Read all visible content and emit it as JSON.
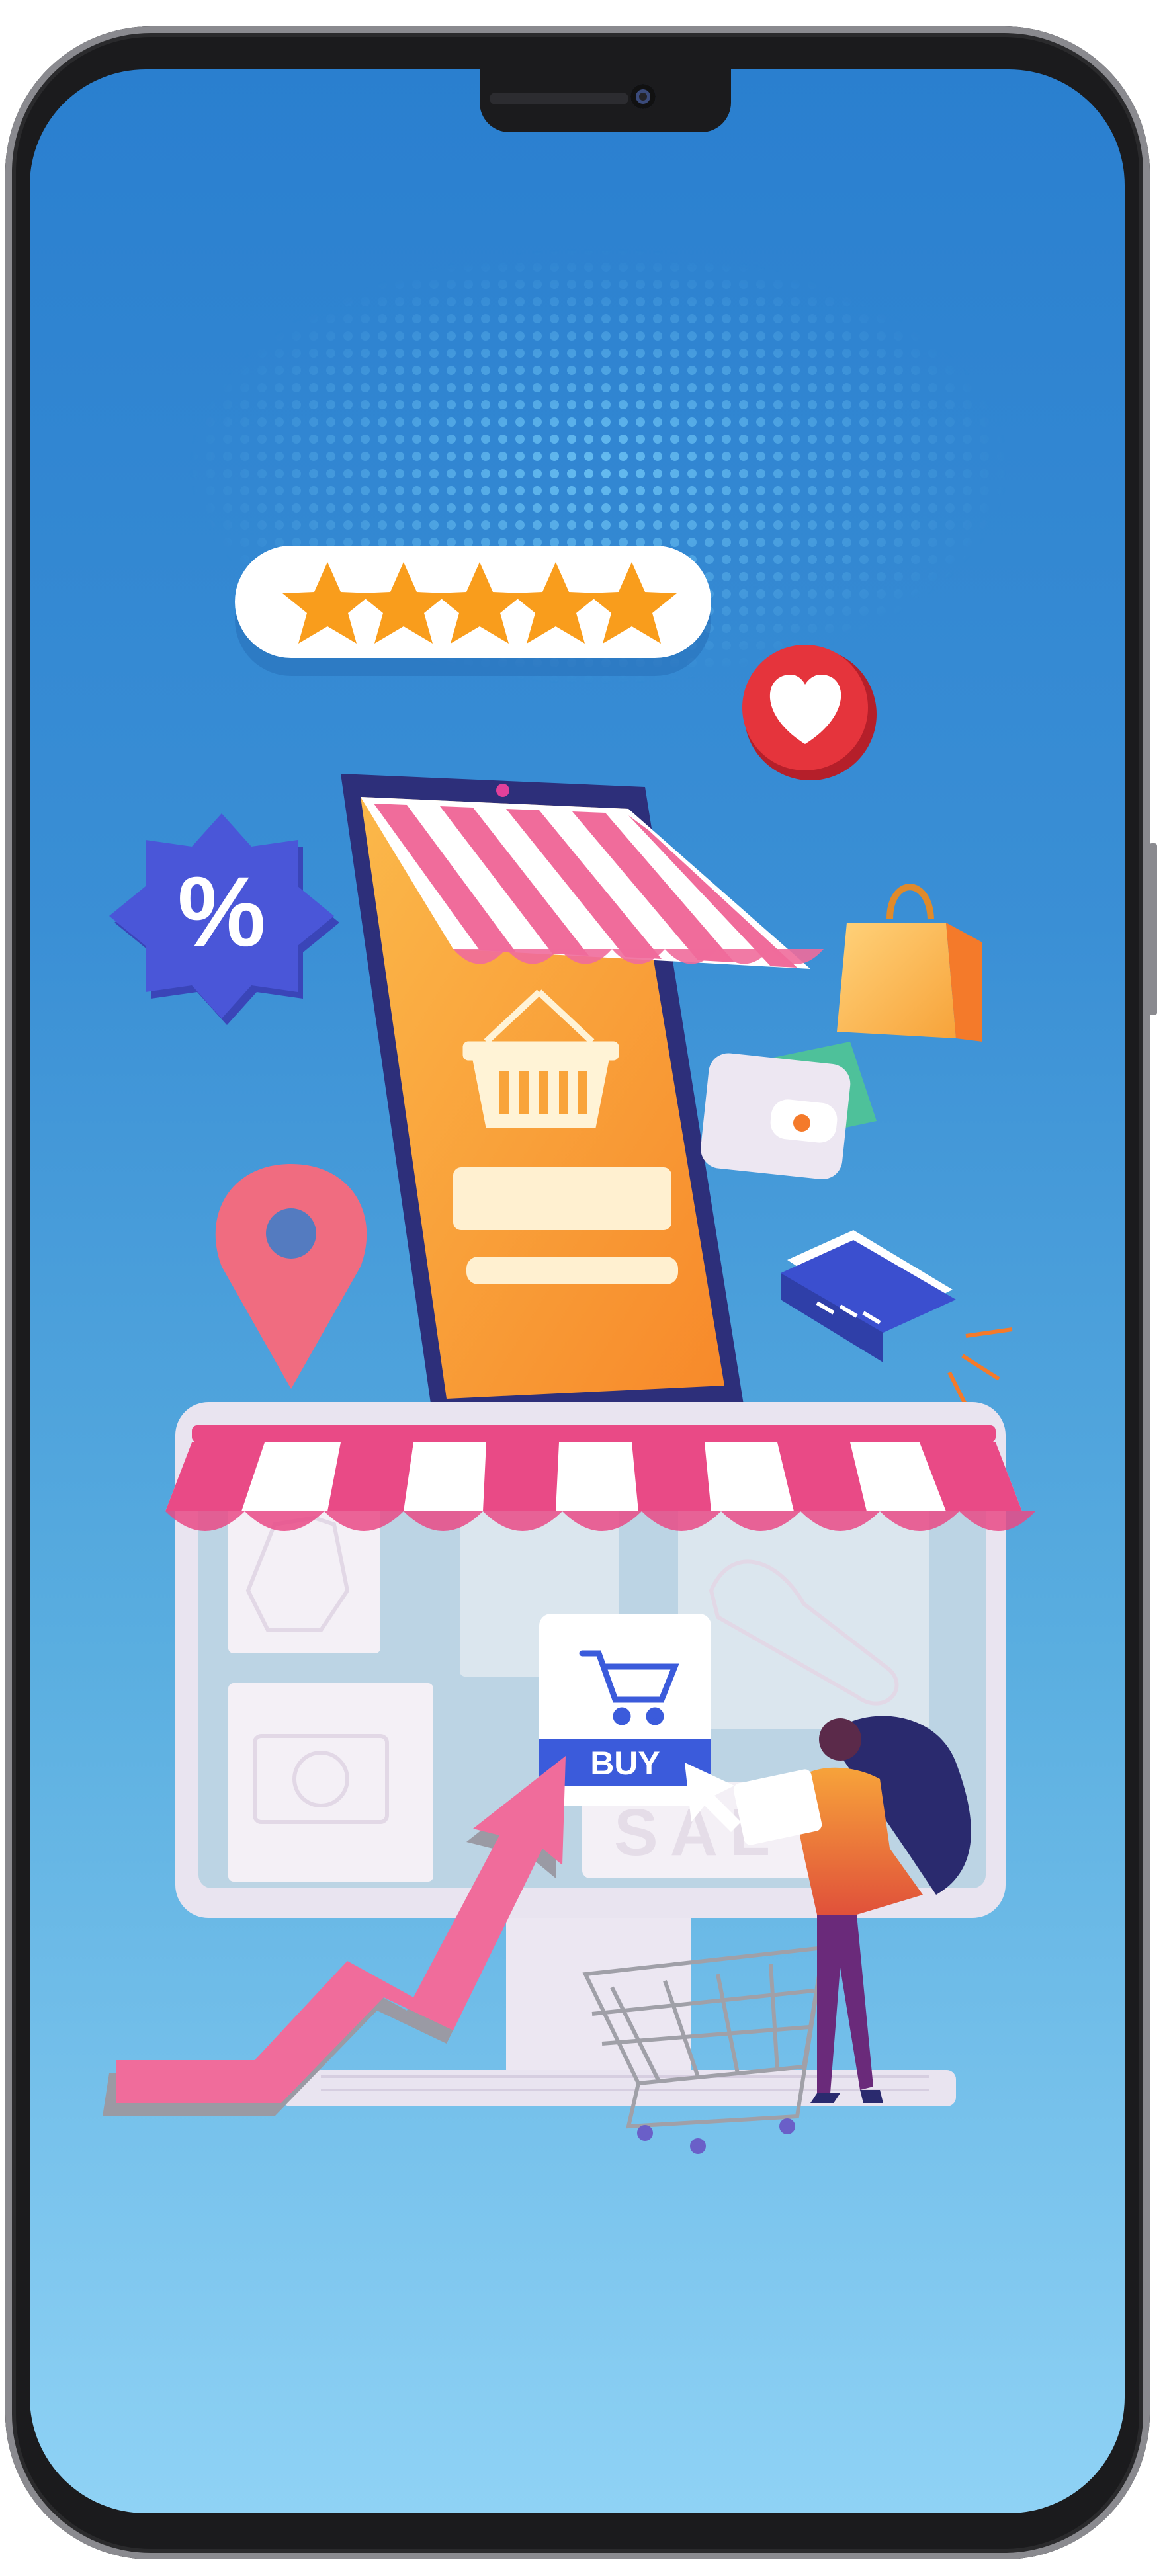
{
  "illustration": {
    "buy_button_label": "BUY",
    "sale_sign_text": "SAL",
    "discount_badge_text": "%",
    "rating_stars": 5
  },
  "colors": {
    "screen_top": "#2a7fcf",
    "screen_bottom": "#8fd2f5",
    "awning_pink": "#e94a86",
    "phone_orange": "#f9a43a",
    "star_orange": "#f99d1c",
    "badge_purple": "#4a56d8",
    "heart_red": "#e5343c",
    "buy_blue": "#3b5bdb"
  }
}
